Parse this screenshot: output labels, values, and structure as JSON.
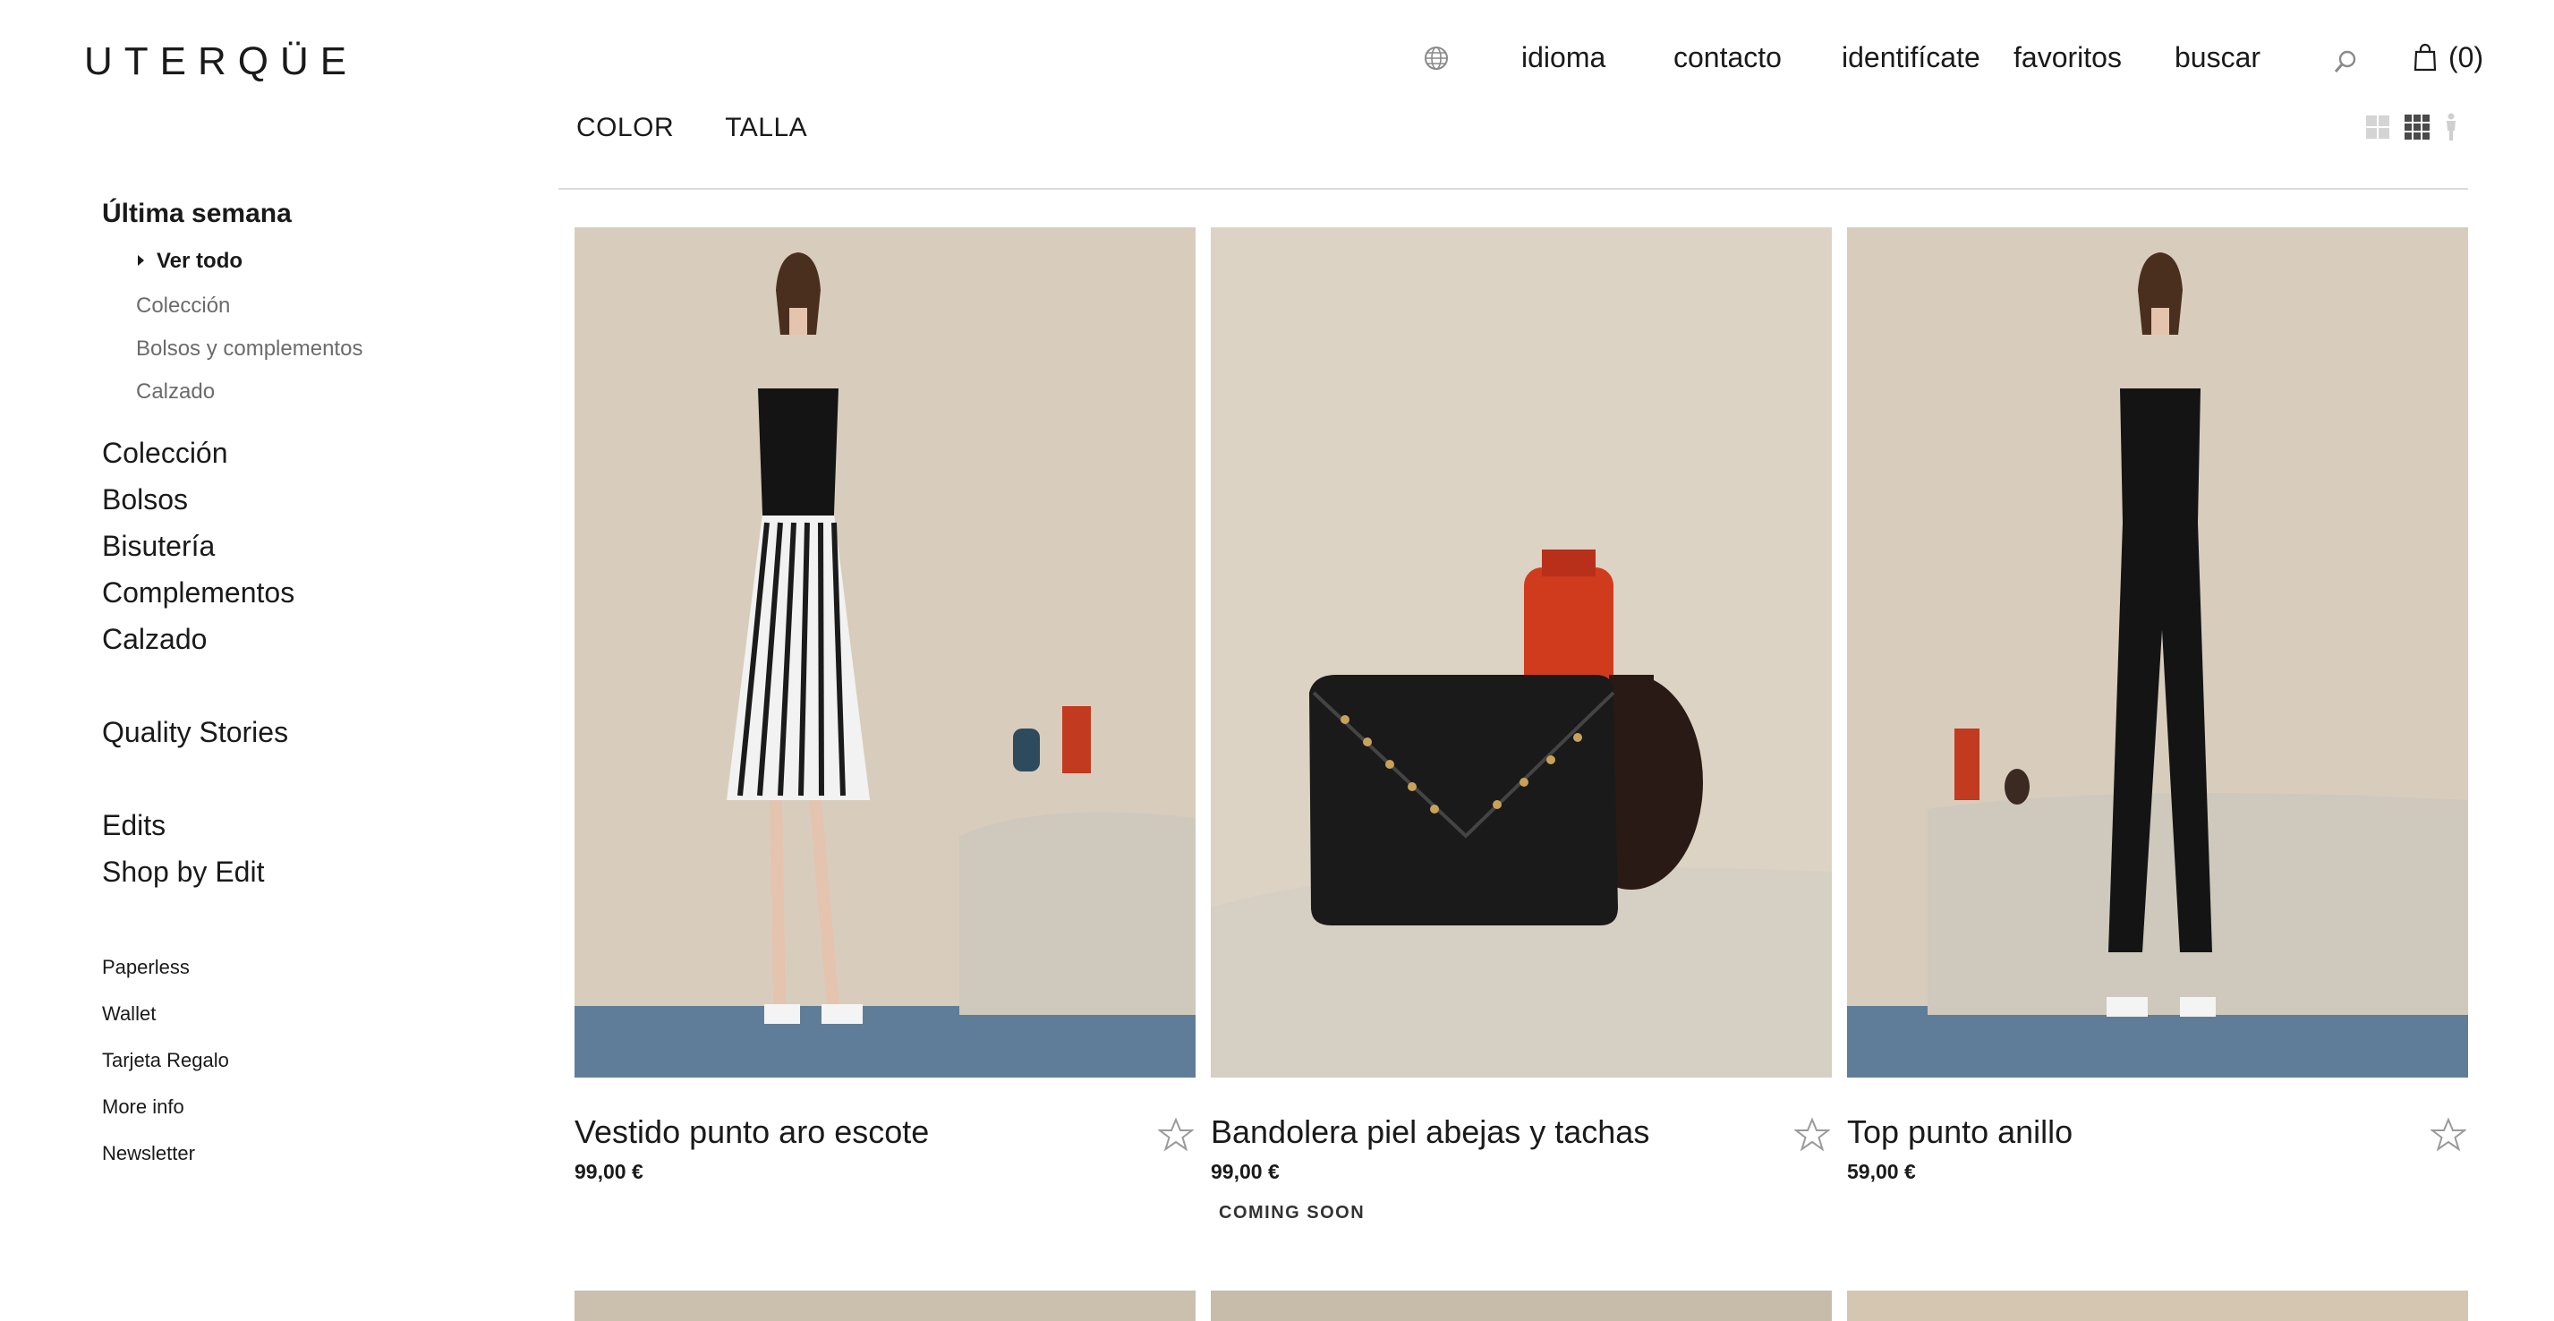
{
  "brand": {
    "logo": "UTERQÜE"
  },
  "topnav": {
    "globe_icon": "globe-icon",
    "language": "idioma",
    "contact": "contacto",
    "login": "identifícate",
    "favorites": "favoritos",
    "search": "buscar",
    "search_icon": "search-icon",
    "bag_icon": "shopping-bag-icon",
    "bag_count": "(0)"
  },
  "filters": {
    "color": "COLOR",
    "size": "TALLA"
  },
  "view_toggles": [
    "grid-2-view-icon",
    "grid-3-view-icon",
    "model-view-icon"
  ],
  "sidebar": {
    "heading": "Última semana",
    "sub_items": [
      "Ver todo",
      "Colección",
      "Bolsos y complementos",
      "Calzado"
    ],
    "categories": [
      "Colección",
      "Bolsos",
      "Bisutería",
      "Complementos",
      "Calzado"
    ],
    "stories": "Quality Stories",
    "edits": [
      "Edits",
      "Shop by Edit"
    ],
    "links": [
      "Paperless",
      "Wallet",
      "Tarjeta Regalo",
      "More info",
      "Newsletter"
    ]
  },
  "products": [
    {
      "name": "Vestido punto aro escote",
      "price": "99,00 €",
      "badge": ""
    },
    {
      "name": "Bandolera piel abejas y tachas",
      "price": "99,00 €",
      "badge": "COMING SOON"
    },
    {
      "name": "Top punto anillo",
      "price": "59,00 €",
      "badge": ""
    }
  ],
  "colors": {
    "text": "#1a1a1a",
    "muted": "#6b6b6b",
    "photo_bg": "#dcd2c3",
    "floor": "#5f7d98"
  }
}
